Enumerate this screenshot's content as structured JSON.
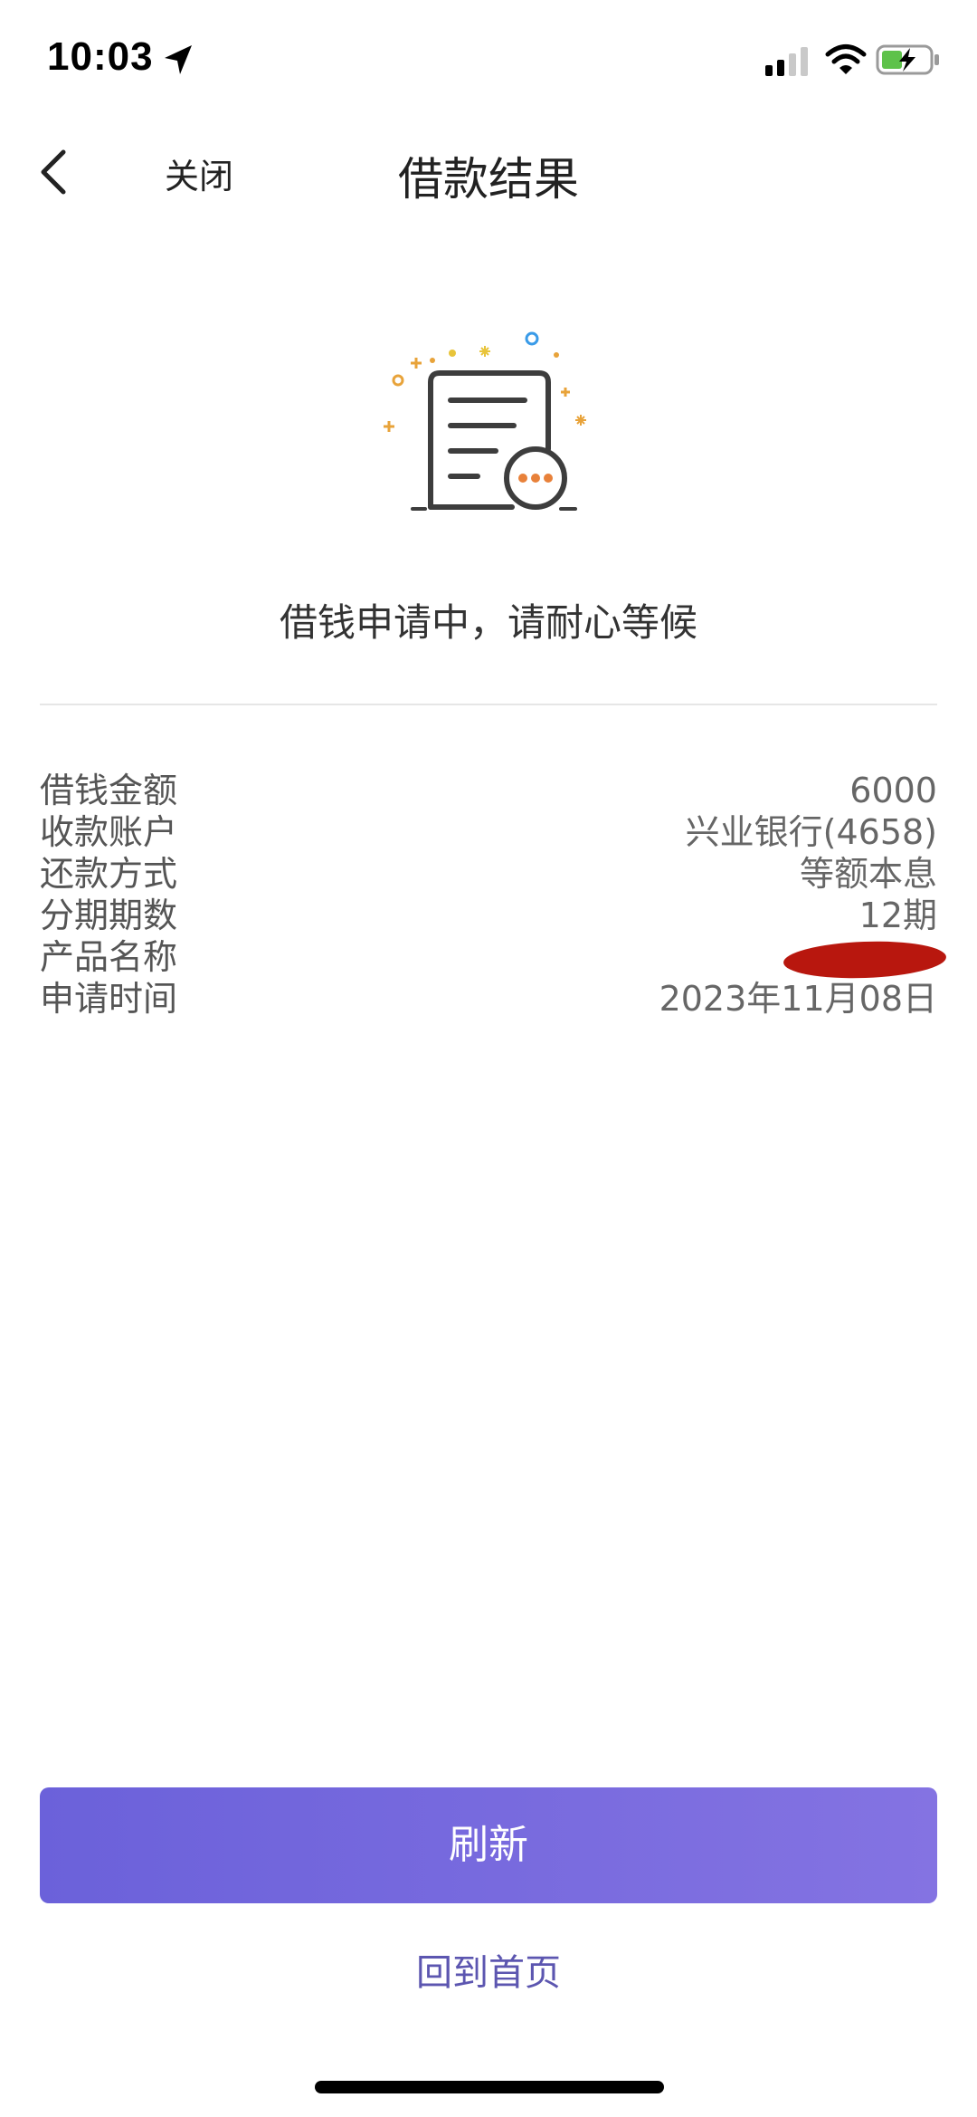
{
  "status_bar": {
    "time": "10:03",
    "icons": [
      "location-arrow-icon",
      "signal-icon",
      "wifi-icon",
      "battery-charging-icon"
    ]
  },
  "nav": {
    "back_icon": "chevron-left-icon",
    "close_label": "关闭",
    "title": "借款结果"
  },
  "status": {
    "icon": "document-pending-icon",
    "message": "借钱申请中，请耐心等候"
  },
  "details": [
    {
      "label": "借钱金额",
      "value": "6000"
    },
    {
      "label": "收款账户",
      "value": "兴业银行(4658)"
    },
    {
      "label": "还款方式",
      "value": "等额本息"
    },
    {
      "label": "分期期数",
      "value": "12期"
    },
    {
      "label": "产品名称",
      "value": ""
    },
    {
      "label": "申请时间",
      "value": "2023年11月08日"
    }
  ],
  "actions": {
    "refresh_label": "刷新",
    "home_label": "回到首页"
  },
  "colors": {
    "primary_start": "#6b61da",
    "primary_end": "#8473e2",
    "link": "#5c56b0",
    "accent_orange": "#e8813a",
    "redaction": "#b8170e"
  }
}
